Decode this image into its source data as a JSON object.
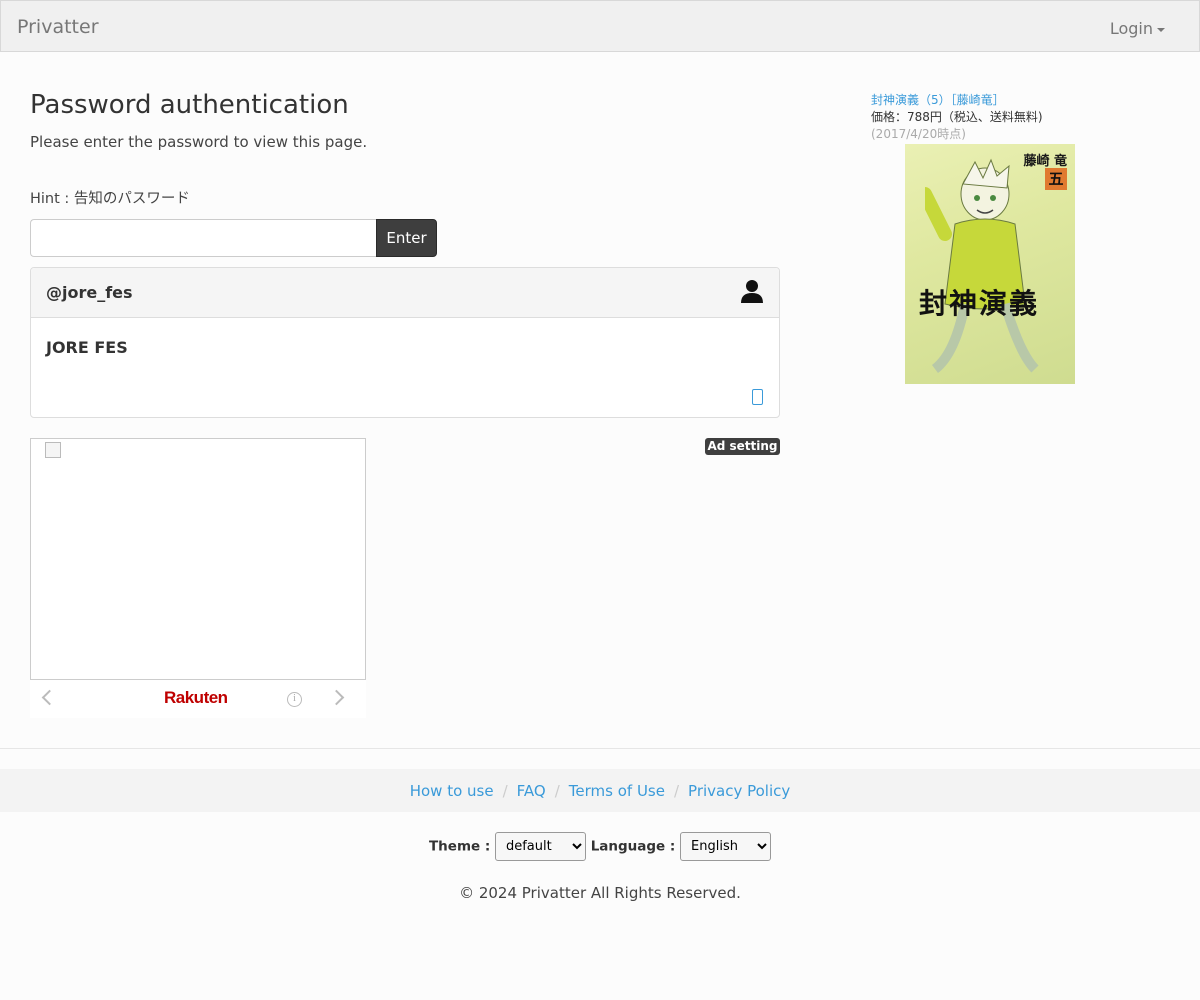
{
  "navbar": {
    "brand": "Privatter",
    "login_label": "Login"
  },
  "main": {
    "title": "Password authentication",
    "subtitle": "Please enter the password to view this page.",
    "hint": "Hint : 告知のパスワード",
    "password_value": "",
    "enter_label": "Enter"
  },
  "card": {
    "username": "@jore_fes",
    "display_name": "JORE FES"
  },
  "ad": {
    "setting_label": "Ad setting",
    "rakuten_logo": "Rakuten",
    "info_glyph": "i"
  },
  "side_ad": {
    "book_title": "封神演義（5）［藤崎竜］",
    "price": "価格：788円（税込、送料無料)",
    "date": "(2017/4/20時点)",
    "cover_author": "藤崎 竜",
    "cover_volume": "五",
    "cover_title": "封神演義"
  },
  "footer": {
    "links": [
      "How to use",
      "FAQ",
      "Terms of Use",
      "Privacy Policy"
    ],
    "separator": "/",
    "theme_label": "Theme :",
    "theme_value": "default",
    "language_label": "Language :",
    "language_value": "English",
    "copyright": "© 2024 Privatter All Rights Reserved."
  },
  "colors": {
    "link": "#3a9ad9",
    "button_dark": "#3e3e3e",
    "rakuten_red": "#bf0000"
  }
}
